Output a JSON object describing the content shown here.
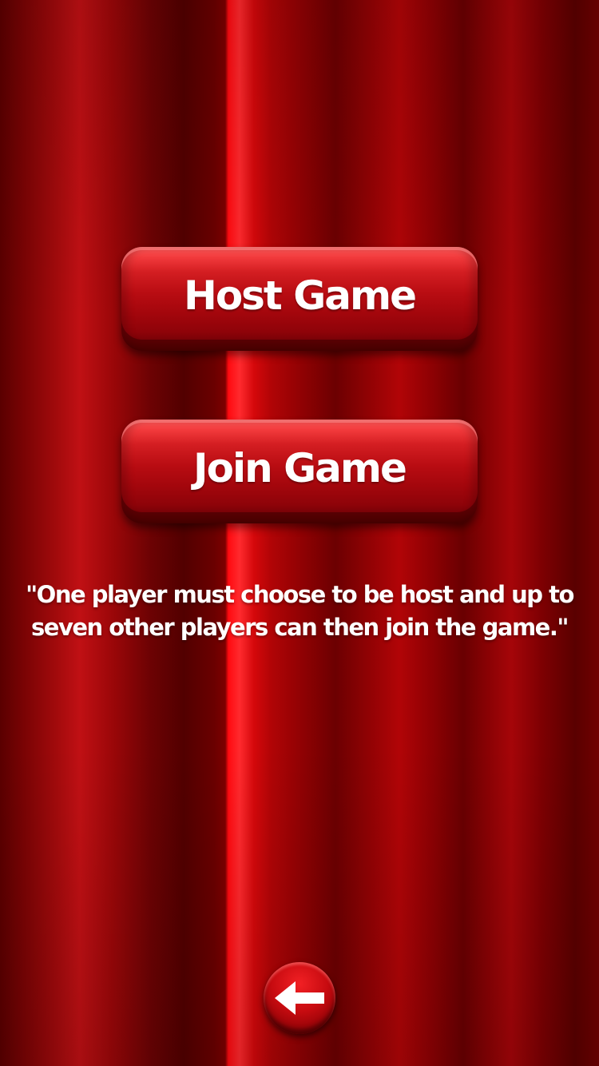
{
  "menu": {
    "host_label": "Host Game",
    "join_label": "Join Game"
  },
  "hint": {
    "text": "\"One player must choose to be host and up to seven other players can then join the game.\""
  },
  "nav": {
    "back_icon": "arrow-left-icon"
  },
  "colors": {
    "curtain": "#8e0103",
    "button": "#b80c12",
    "text": "#ffffff"
  }
}
